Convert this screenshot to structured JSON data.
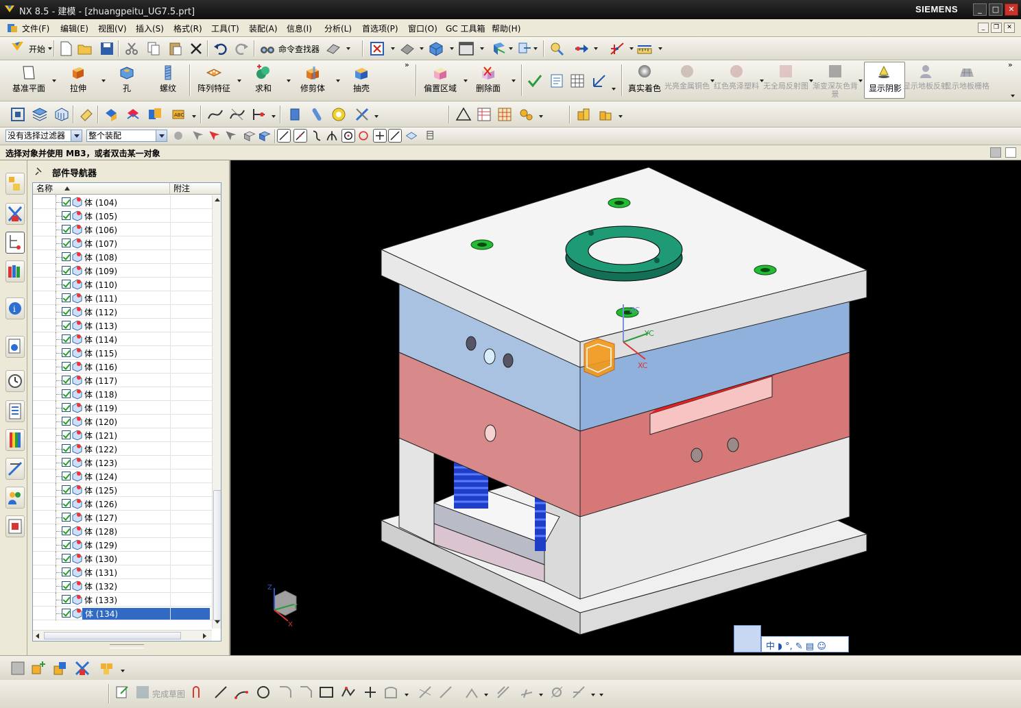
{
  "window": {
    "title": "NX 8.5 - 建模 - [zhuangpeitu_UG7.5.prt]",
    "brand": "SIEMENS",
    "buttons": [
      "_",
      "□",
      "✕"
    ]
  },
  "menu": {
    "items": [
      "文件(F)",
      "编辑(E)",
      "视图(V)",
      "插入(S)",
      "格式(R)",
      "工具(T)",
      "装配(A)",
      "信息(I)",
      "分析(L)",
      "首选项(P)",
      "窗口(O)",
      "GC 工具箱",
      "帮助(H)"
    ]
  },
  "standard_toolbar": {
    "start_label": "开始",
    "command_finder": "命令查找器"
  },
  "feature_toolbar": {
    "items": [
      "基准平面",
      "拉伸",
      "孔",
      "螺纹",
      "阵列特征",
      "求和",
      "修剪体",
      "抽壳",
      "偏置区域",
      "删除面"
    ],
    "render_items": [
      "真实着色",
      "光亮金属铜色",
      "红色亮泽塑料",
      "无全局反射图",
      "渐变深灰色背景",
      "显示阴影",
      "显示地板反射",
      "显示地板栅格"
    ],
    "active_render": "显示阴影"
  },
  "selection_bar": {
    "filter_value": "没有选择过滤器",
    "scope_value": "整个装配"
  },
  "status": {
    "prompt": "选择对象并使用 MB3，或者双击某一对象"
  },
  "navigator": {
    "title": "部件导航器",
    "col_name": "名称",
    "col_note": "附注",
    "rows": [
      "体 (104)",
      "体 (105)",
      "体 (106)",
      "体 (107)",
      "体 (108)",
      "体 (109)",
      "体 (110)",
      "体 (111)",
      "体 (112)",
      "体 (113)",
      "体 (114)",
      "体 (115)",
      "体 (116)",
      "体 (117)",
      "体 (118)",
      "体 (119)",
      "体 (120)",
      "体 (121)",
      "体 (122)",
      "体 (123)",
      "体 (124)",
      "体 (125)",
      "体 (126)",
      "体 (127)",
      "体 (128)",
      "体 (129)",
      "体 (130)",
      "体 (131)",
      "体 (132)",
      "体 (133)",
      "体 (134)"
    ],
    "selected_row": "体 (134)"
  },
  "viewport": {
    "csys_labels": {
      "zc": "ZC",
      "yc": "YC",
      "xc": "XC"
    },
    "triad_labels": {
      "z": "Z",
      "y": "Y",
      "x": "X"
    },
    "ime_bar": "中 ◗ °, ✎ ▤ ☺"
  },
  "sketch_toolbar": {
    "finish_sketch": "完成草图"
  },
  "colors": {
    "top_plate": "#f2f2f2",
    "cavity_plate": "#a8c1e0",
    "core_plate": "#d98080",
    "support": "#e5e5e5",
    "ring": "#1e8a6a",
    "selection": "#316ac5"
  }
}
